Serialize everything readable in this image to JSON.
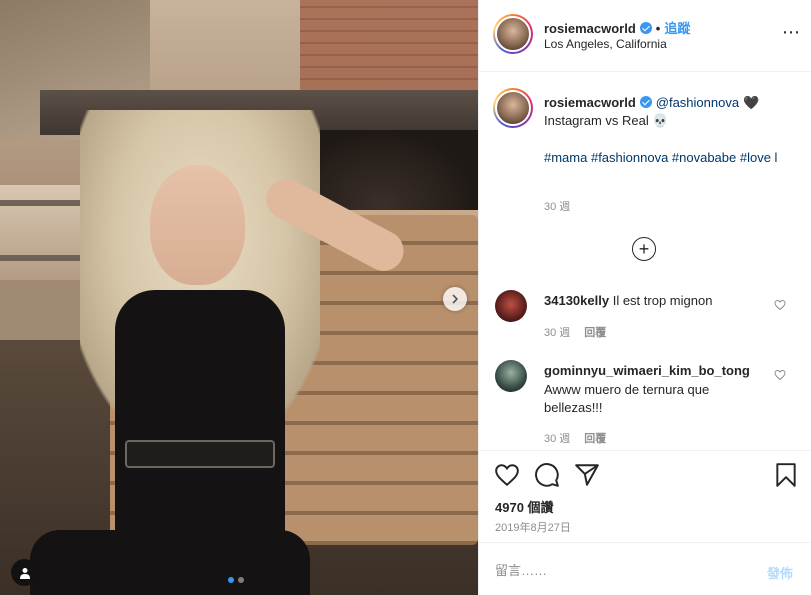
{
  "post": {
    "username": "rosiemacworld",
    "follow_label": "追蹤",
    "bullet": "•",
    "location": "Los Angeles, California",
    "more_icon": "⋯"
  },
  "caption": {
    "username": "rosiemacworld",
    "mention": "@fashionnova",
    "heart": "🖤",
    "line1": "Instagram vs Real 💀",
    "hashtags": "#mama #fashionnova #novababe #love l",
    "time": "30 週"
  },
  "load_more_icon": "+",
  "comments": [
    {
      "username": "34130kelly",
      "text": "Il est trop mignon",
      "time": "30 週",
      "reply": "回覆"
    },
    {
      "username": "gominnyu_wimaeri_kim_bo_tong",
      "text": "Awww muero de ternura que bellezas!!!",
      "time": "30 週",
      "reply": "回覆"
    }
  ],
  "stats": {
    "views": "4970 個讚",
    "date": "2019年8月27日"
  },
  "comment_box": {
    "placeholder": "留言……",
    "post_label": "發佈"
  },
  "carousel": {
    "total_slides": 2,
    "active_slide": 1
  },
  "colors": {
    "accent": "#3897f0",
    "link": "#00376b",
    "muted": "#8e8e8e",
    "post_disabled": "#b3dbff"
  }
}
